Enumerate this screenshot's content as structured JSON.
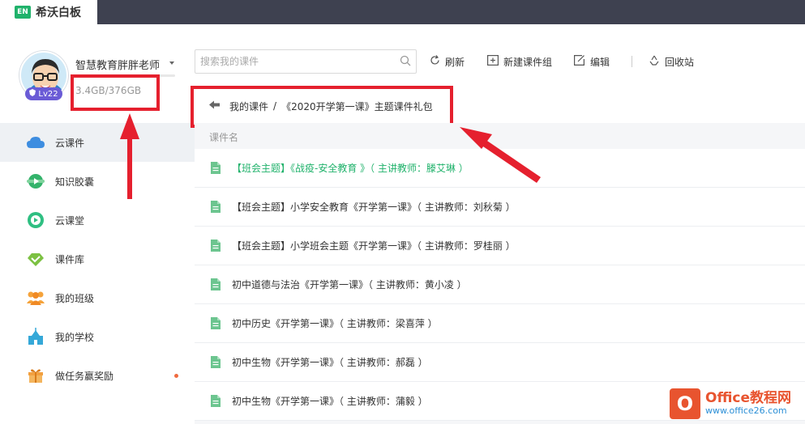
{
  "app": {
    "logo_text": "EN",
    "title": "希沃白板"
  },
  "user": {
    "name": "智慧教育胖胖老师",
    "level": "Lv22",
    "storage": "3.4GB/376GB",
    "storage_used_fraction": 0.009
  },
  "sidebar": {
    "items": [
      {
        "label": "云课件",
        "icon": "cloud-icon",
        "active": true
      },
      {
        "label": "知识胶囊",
        "icon": "capsule-icon",
        "active": false
      },
      {
        "label": "云课堂",
        "icon": "play-circle-icon",
        "active": false
      },
      {
        "label": "课件库",
        "icon": "library-icon",
        "active": false
      },
      {
        "label": "我的班级",
        "icon": "class-icon",
        "active": false
      },
      {
        "label": "我的学校",
        "icon": "school-icon",
        "active": false
      },
      {
        "label": "做任务赢奖励",
        "icon": "gift-icon",
        "active": false,
        "dot": true
      }
    ]
  },
  "toolbar": {
    "search_placeholder": "搜索我的课件",
    "refresh": "刷新",
    "new_group": "新建课件组",
    "edit": "编辑",
    "recycle": "回收站"
  },
  "breadcrumb": {
    "root": "我的课件",
    "separator": "/",
    "current": "《2020开学第一课》主题课件礼包"
  },
  "list": {
    "column_header": "课件名",
    "rows": [
      {
        "name": "【班会主题】《战疫-安全教育 》（ 主讲教师：滕艾琳 ）",
        "highlight": true
      },
      {
        "name": "【班会主题】小学安全教育《开学第一课》（ 主讲教师：刘秋菊 ）",
        "highlight": false
      },
      {
        "name": "【班会主题】小学班会主题《开学第一课》（ 主讲教师：罗桂丽 ）",
        "highlight": false
      },
      {
        "name": "初中道德与法治《开学第一课》（ 主讲教师：黄小凌 ）",
        "highlight": false
      },
      {
        "name": "初中历史《开学第一课》（ 主讲教师：梁喜萍 ）",
        "highlight": false
      },
      {
        "name": "初中生物《开学第一课》（ 主讲教师：郝磊 ）",
        "highlight": false
      },
      {
        "name": "初中生物《开学第一课》（ 主讲教师：蒲毅 ）",
        "highlight": false
      }
    ]
  },
  "watermark": {
    "logo_text": "O",
    "title": "Office教程网",
    "url": "www.office26.com"
  },
  "colors": {
    "accent": "#20b26b",
    "annotation": "#e5202e",
    "topbar": "#3e4150"
  }
}
